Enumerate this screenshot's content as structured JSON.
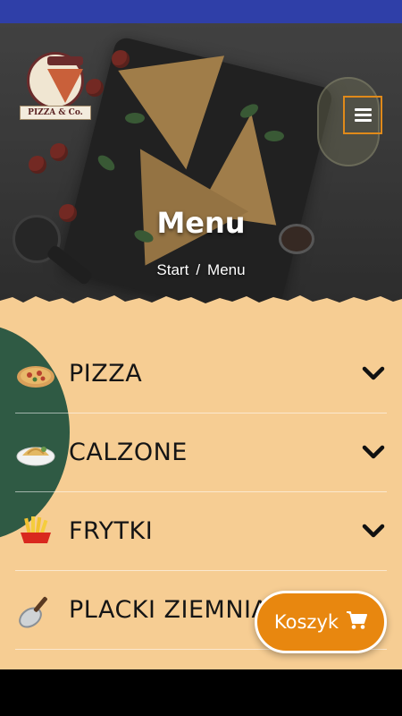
{
  "hero": {
    "title": "Menu",
    "breadcrumb": {
      "home": "Start",
      "separator": "/",
      "current": "Menu"
    }
  },
  "logo": {
    "name": "PIZZA & Co.",
    "tagline": "(partially illegible)"
  },
  "nav": {
    "menu_icon": "hamburger-icon"
  },
  "categories": [
    {
      "label": "PIZZA",
      "icon": "pizza-icon"
    },
    {
      "label": "CALZONE",
      "icon": "calzone-icon"
    },
    {
      "label": "FRYTKI",
      "icon": "fries-icon"
    },
    {
      "label": "PLACKI ZIEMNIACZANE",
      "icon": "pan-icon"
    }
  ],
  "cart": {
    "label": "Koszyk",
    "icon": "cart-icon"
  },
  "colors": {
    "accent": "#e8870f",
    "section_bg": "#f6cd93",
    "blob": "#2f5a44",
    "status_bar": "#2f3fa8"
  }
}
